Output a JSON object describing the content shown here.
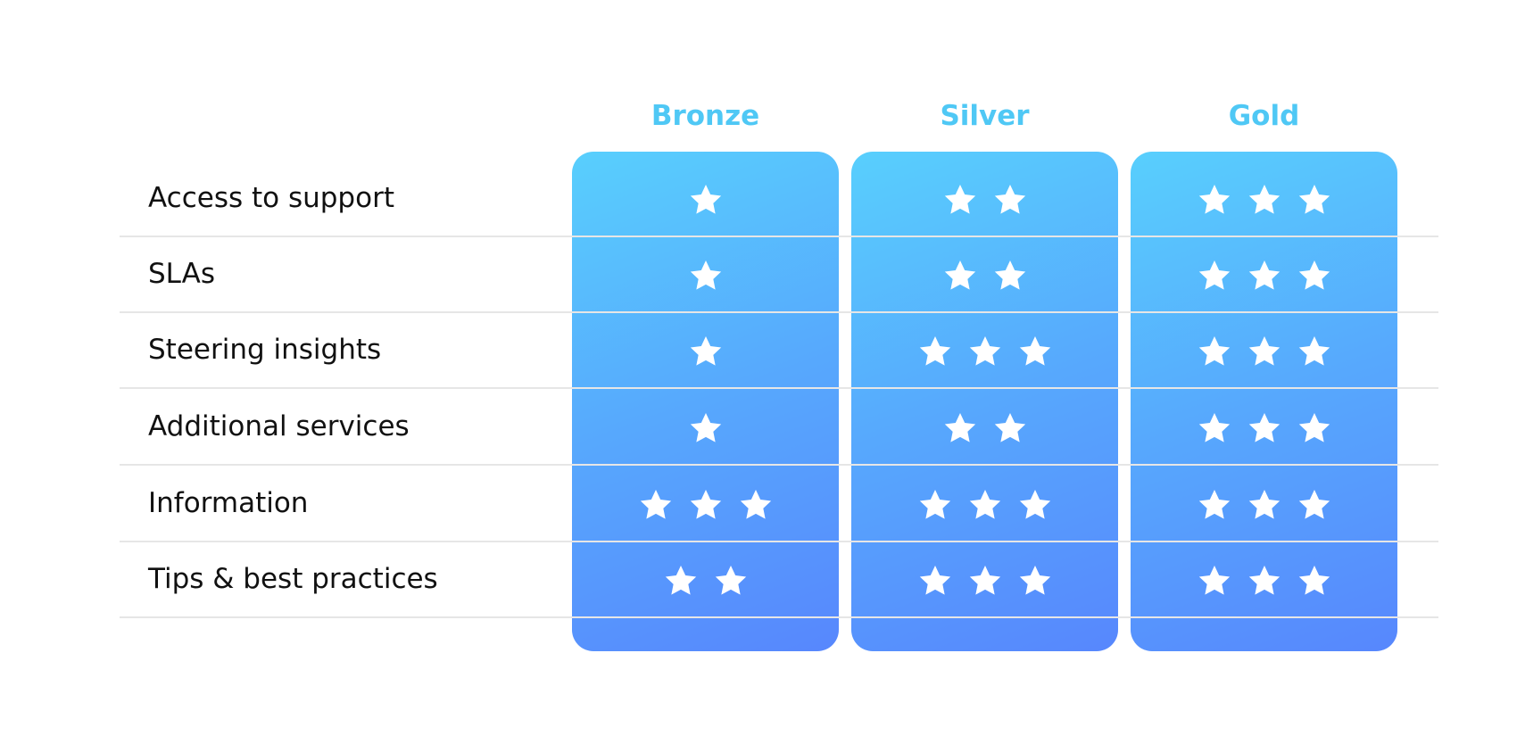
{
  "tiers": [
    {
      "name": "Bronze"
    },
    {
      "name": "Silver"
    },
    {
      "name": "Gold"
    }
  ],
  "rows": [
    {
      "label": "Access to support",
      "stars": [
        1,
        2,
        3
      ]
    },
    {
      "label": "SLAs",
      "stars": [
        1,
        2,
        3
      ]
    },
    {
      "label": "Steering insights",
      "stars": [
        1,
        3,
        3
      ]
    },
    {
      "label": "Additional services",
      "stars": [
        1,
        2,
        3
      ]
    },
    {
      "label": "Information",
      "stars": [
        3,
        3,
        3
      ]
    },
    {
      "label": "Tips & best practices",
      "stars": [
        2,
        3,
        3
      ]
    }
  ],
  "colors": {
    "gradient_start": "#58CFFD",
    "gradient_end": "#5787FD",
    "tier_title": "#4FC8F5"
  }
}
